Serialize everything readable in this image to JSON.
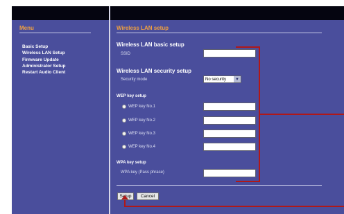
{
  "menu": {
    "title": "Menu",
    "items": [
      "Basic Setup",
      "Wireless LAN Setup",
      "Firmware Update",
      "Administrator Setup",
      "Restart Audio Client"
    ]
  },
  "page": {
    "title": "Wireless LAN setup"
  },
  "basic": {
    "heading": "Wireless LAN basic setup",
    "ssid_label": "SSID",
    "ssid_value": ""
  },
  "security": {
    "heading": "Wireless LAN security setup",
    "mode_label": "Security mode",
    "mode_value": "No security"
  },
  "wep": {
    "heading": "WEP key setup",
    "keys": [
      {
        "label": "WEP key No.1",
        "value": ""
      },
      {
        "label": "WEP key No.2",
        "value": ""
      },
      {
        "label": "WEP key No.3",
        "value": ""
      },
      {
        "label": "WEP key No.4",
        "value": ""
      }
    ]
  },
  "wpa": {
    "heading": "WPA key setup",
    "key_label": "WPA key (Pass phrase)",
    "key_value": ""
  },
  "buttons": {
    "setup": "Setup",
    "cancel": "Cancel"
  },
  "colors": {
    "panel": "#4a4e9c",
    "accent_orange": "#f0a040",
    "callout_red": "#b01818",
    "topbar": "#050510"
  }
}
